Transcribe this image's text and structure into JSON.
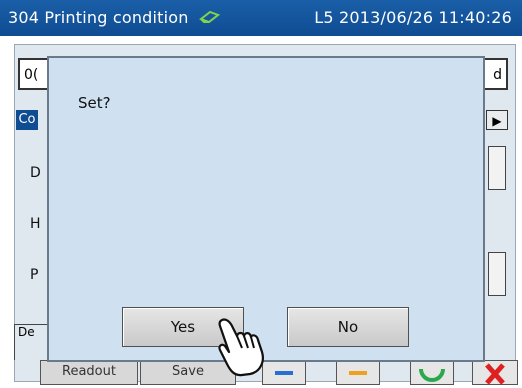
{
  "titlebar": {
    "screen_code": "304 Printing condition",
    "status": "L5 2013/06/26 11:40:26",
    "icon": "eraser-icon"
  },
  "background": {
    "field_left": "0(",
    "field_right": "d",
    "tab_left": "Co",
    "rows": [
      "D",
      "H",
      "P"
    ],
    "group_label": "De",
    "bottom_buttons": [
      "Readout",
      "Save"
    ]
  },
  "dialog": {
    "message": "Set?",
    "yes_label": "Yes",
    "no_label": "No"
  },
  "colors": {
    "titlebar": "#0f4c92",
    "dialog_bg": "#cfe1f0",
    "button_bg": "#d6d6d6"
  }
}
